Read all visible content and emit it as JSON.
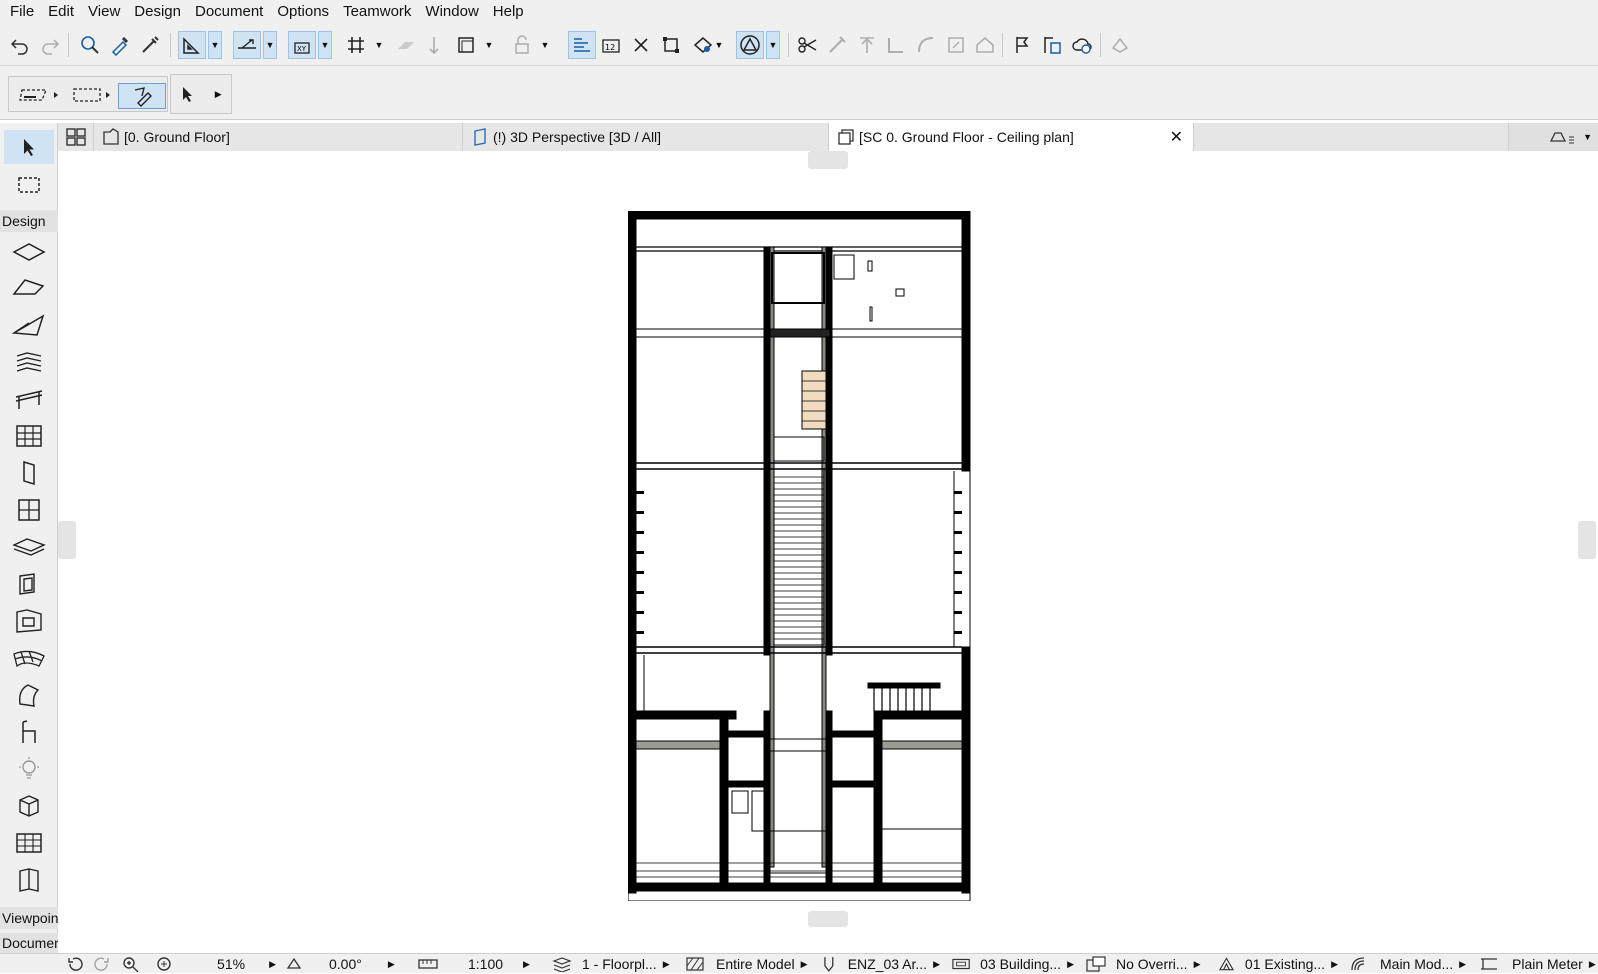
{
  "menu": [
    "File",
    "Edit",
    "View",
    "Design",
    "Document",
    "Options",
    "Teamwork",
    "Window",
    "Help"
  ],
  "toolbar_icons": [
    "undo-icon",
    "redo-icon",
    "find-select-icon",
    "eyedropper-icon",
    "syringe-icon",
    "guide-lines-icon",
    "snap-guides-icon",
    "coordinates-icon",
    "grid-snap-icon",
    "surface-icon",
    "gravity-icon",
    "view-cube-icon",
    "lock-icon",
    "trace-icon",
    "dimension-icon",
    "cross-icon",
    "fit-window-icon",
    "renovation-icon",
    "triangle-icon",
    "scissors-icon",
    "wand-icon",
    "elevate-icon",
    "corner-icon",
    "fillet-icon",
    "resize-icon",
    "roof-icon",
    "flag-icon",
    "publish-icon",
    "cloud-icon",
    "bimcloud-icon"
  ],
  "tabs": [
    {
      "label": "[0. Ground Floor]",
      "icon": "floor-plan-icon",
      "active": false
    },
    {
      "label": "(!) 3D Perspective [3D / All]",
      "icon": "3d-view-icon",
      "active": false
    },
    {
      "label": "[SC 0. Ground Floor - Ceiling plan]",
      "icon": "section-view-icon",
      "active": true
    }
  ],
  "toolbox": {
    "design_header": "Design",
    "viewpoint_header": "Viewpoints",
    "document_header": "Document",
    "tools": [
      "arrow-tool-icon",
      "marquee-tool-icon",
      "wall-tool-icon",
      "beam-tool-icon",
      "roof-tool-icon",
      "stair-tool-icon",
      "railing-tool-icon",
      "curtain-wall-tool-icon",
      "door-tool-icon",
      "window-tool-icon",
      "slab-tool-icon",
      "column-tool-icon",
      "object-tool-icon",
      "mesh-tool-icon",
      "shell-tool-icon",
      "chair-tool-icon",
      "lamp-tool-icon",
      "morph-tool-icon",
      "zone-tool-icon",
      "skylight-tool-icon"
    ]
  },
  "status": {
    "zoom": "51%",
    "angle": "0.00°",
    "scale": "1:100",
    "layer": "1 - Floorpl...",
    "model": "Entire Model",
    "pen": "ENZ_03 Ar...",
    "structure": "03 Building...",
    "override": "No Overri...",
    "renovation": "01 Existing...",
    "model_view": "Main Mod...",
    "units": "Plain Meter"
  }
}
